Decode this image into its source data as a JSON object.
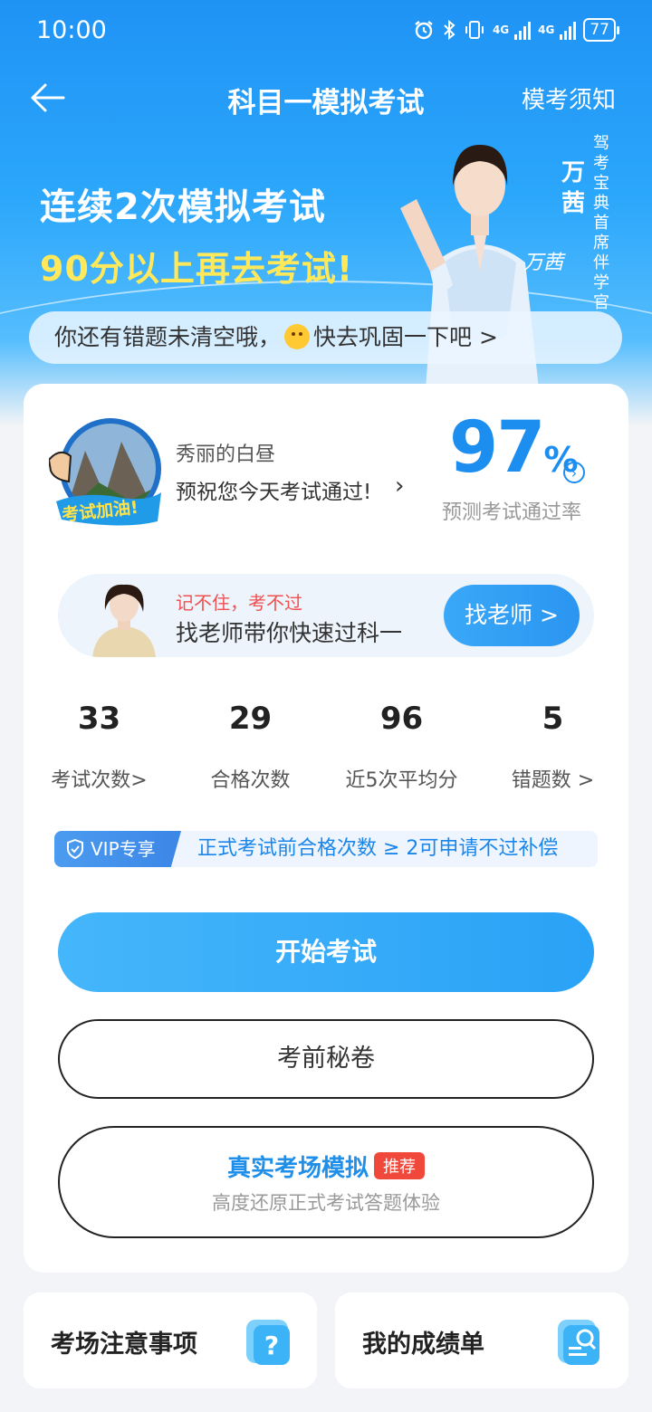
{
  "status_bar": {
    "time": "10:00",
    "network": "4G",
    "battery": "77"
  },
  "nav": {
    "title": "科目一模拟考试",
    "notice_link": "模考须知"
  },
  "hero": {
    "headline_1": "连续2次模拟考试",
    "headline_2": "90分以上再去考试!",
    "presenter_name": "万茜",
    "presenter_title": "驾考宝典首席伴学官",
    "signature": "万茜"
  },
  "wrong_banner": {
    "before_text": "你还有错题未清空哦，",
    "after_text": "快去巩固一下吧 >"
  },
  "profile": {
    "badge_text": "考试加油!",
    "user_name": "秀丽的白昼",
    "wish": "预祝您今天考试通过!",
    "pass_rate": "97",
    "pass_rate_unit": "%",
    "pass_rate_label": "预测考试通过率"
  },
  "teacher": {
    "tag": "记不住，考不过",
    "line": "找老师带你快速过科一",
    "button": "找老师 >"
  },
  "stats": [
    {
      "value": "33",
      "label": "考试次数>"
    },
    {
      "value": "29",
      "label": "合格次数"
    },
    {
      "value": "96",
      "label": "近5次平均分"
    },
    {
      "value": "5",
      "label": "错题数 >"
    }
  ],
  "vip": {
    "tag": "VIP专享",
    "text": "正式考试前合格次数 ≥ 2可申请不过补偿"
  },
  "buttons": {
    "start": "开始考试",
    "secret": "考前秘卷",
    "real_title": "真实考场模拟",
    "real_badge": "推荐",
    "real_sub": "高度还原正式考试答题体验"
  },
  "tiles": [
    {
      "label": "考场注意事项",
      "icon": "question-icon"
    },
    {
      "label": "我的成绩单",
      "icon": "scorecard-icon"
    }
  ],
  "colors": {
    "primary": "#2aa2f6",
    "accent_yellow": "#ffe95a",
    "badge_red": "#f0493c",
    "tag_red": "#f05050"
  }
}
